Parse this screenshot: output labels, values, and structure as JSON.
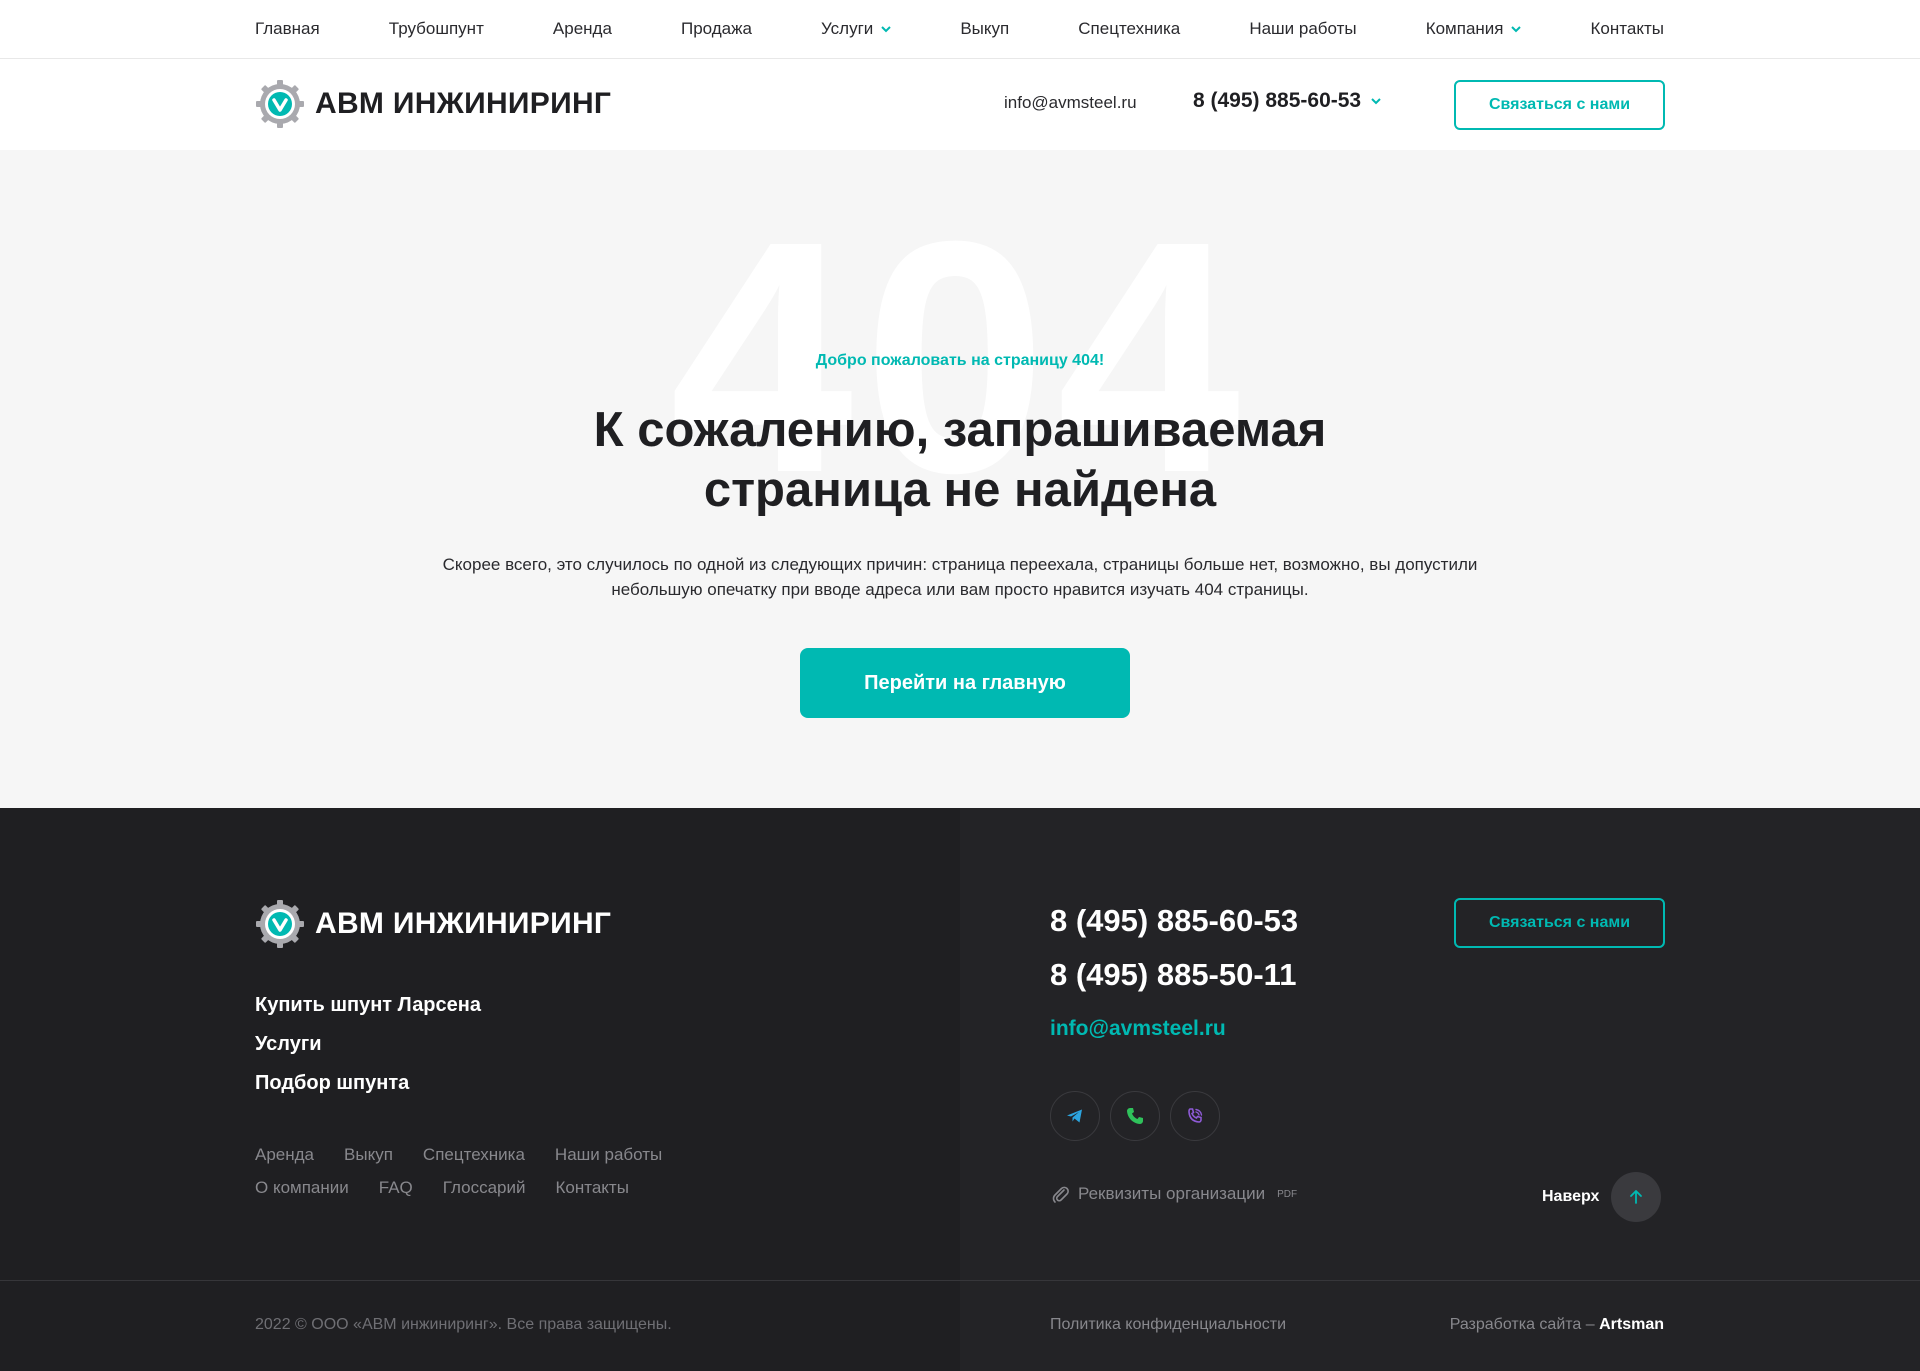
{
  "nav": {
    "items": [
      {
        "label": "Главная"
      },
      {
        "label": "Трубошпунт"
      },
      {
        "label": "Аренда"
      },
      {
        "label": "Продажа"
      },
      {
        "label": "Услуги",
        "has_dropdown": true
      },
      {
        "label": "Выкуп"
      },
      {
        "label": "Спецтехника"
      },
      {
        "label": "Наши работы"
      },
      {
        "label": "Компания",
        "has_dropdown": true
      },
      {
        "label": "Контакты"
      }
    ]
  },
  "header": {
    "logo_text": "АВМ ИНЖИНИРИНГ",
    "email": "info@avmsteel.ru",
    "phone": "8 (495) 885-60-53",
    "contact_button": "Связаться с нами"
  },
  "error": {
    "big_code": "404",
    "welcome": "Добро пожаловать на страницу 404!",
    "title_line1": "К сожалению, запрашиваемая",
    "title_line2": "страница не найдена",
    "description_line1": "Скорее всего, это случилось по одной из следующих причин: страница переехала, страницы больше нет, возможно, вы допустили",
    "description_line2": "небольшую опечатку при вводе адреса или вам просто нравится изучать 404 страницы.",
    "home_button": "Перейти на главную"
  },
  "footer": {
    "logo_text": "АВМ ИНЖИНИРИНГ",
    "main_links": [
      "Купить шпунт Ларсена",
      "Услуги",
      "Подбор шпунта"
    ],
    "secondary_links": [
      "Аренда",
      "Выкуп",
      "Спецтехника",
      "Наши работы",
      "О компании",
      "FAQ",
      "Глоссарий",
      "Контакты"
    ],
    "phone1": "8 (495) 885-60-53",
    "phone2": "8 (495) 885-50-11",
    "email": "info@avmsteel.ru",
    "contact_button": "Связаться с нами",
    "socials": [
      "telegram-icon",
      "phone-icon",
      "viber-icon"
    ],
    "requisites": "Реквизиты организации",
    "requisites_badge": "PDF",
    "to_top": "Наверх",
    "copyright": "2022 © ООО «АВМ инжиниринг». Все права защищены.",
    "policy": "Политика конфиденциальности",
    "developer_prefix": "Разработка сайта –",
    "developer_name": "Artsman"
  },
  "colors": {
    "accent": "#00b9b2",
    "dark": "#1f1f22",
    "hero_bg": "#f6f6f6"
  }
}
